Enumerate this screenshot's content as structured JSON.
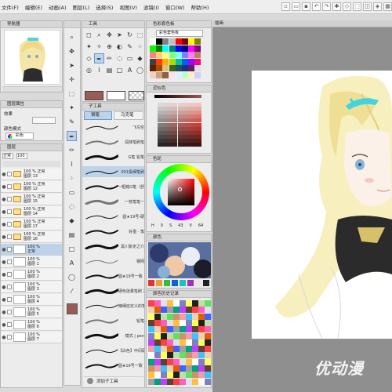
{
  "menu": [
    "文件(F)",
    "编辑(E)",
    "动画(A)",
    "图层(L)",
    "选择(S)",
    "视图(V)",
    "滤镜(I)",
    "窗口(W)",
    "帮助(H)"
  ],
  "navigator": {
    "title": "导航器"
  },
  "layer_property": {
    "title": "图层属性",
    "effect_label": "效果",
    "color_mode_label": "颜色模式",
    "color_value": "彩色"
  },
  "layers_panel": {
    "title": "图层",
    "blend": "正常",
    "opacity": "100",
    "rows": [
      {
        "text": "100 % 正常\n图层 13",
        "type": "folder"
      },
      {
        "text": "100 % 正常\n图层 12",
        "type": "folder"
      },
      {
        "text": "100 % 正常\n图层 15",
        "type": "folder"
      },
      {
        "text": "100 % 正常\n图层 14",
        "type": "folder"
      },
      {
        "text": "100 % 正常\n图层 17",
        "type": "folder"
      },
      {
        "text": "100 % 正常\n图层 16",
        "type": "folder"
      },
      {
        "text": "100 %\n正常",
        "type": "layer",
        "selected": true
      },
      {
        "text": "100 %\n图层 1",
        "type": "layer"
      },
      {
        "text": "100 %\n图层 2",
        "type": "layer"
      },
      {
        "text": "100 %\n图层 3",
        "type": "layer"
      },
      {
        "text": "100 %\n图层 4",
        "type": "layer"
      },
      {
        "text": "100 %\n图层 5",
        "type": "layer"
      },
      {
        "text": "100 %\n图层 6",
        "type": "layer"
      },
      {
        "text": "100 %\n图层 7",
        "type": "layer"
      }
    ]
  },
  "tools_panel": {
    "title": "工具"
  },
  "sub_tool": {
    "title": "子工具",
    "tab_pen": "钢笔",
    "tab_marker": "马克笔",
    "brushes": [
      {
        "name": "飞鸟空"
      },
      {
        "name": "润抹笔刷笔"
      },
      {
        "name": "G笔 铅笔"
      },
      {
        "name": "001极细笔刷"
      },
      {
        "name": "~粗糙G笔（舒华"
      },
      {
        "name": "一枝笔笔一"
      },
      {
        "name": "圆★19号-硬"
      },
      {
        "name": "好墨 · 笔"
      },
      {
        "name": "黑川复定之介"
      },
      {
        "name": "钢网"
      },
      {
        "name": "圆★19号一致（柔）"
      },
      {
        "name": "硬色批量笔刷 2"
      },
      {
        "name": "精细自定义的笔"
      },
      {
        "name": "铅笔"
      },
      {
        "name": "模式 | pen"
      },
      {
        "name": "【白色】中间硬中空笔 1"
      },
      {
        "name": "圆★19号一致（柔）"
      }
    ],
    "add_label": "添加子工具"
  },
  "color_set": {
    "title": "色彩套色板",
    "dropdown": "彩色套色板"
  },
  "color_history": {
    "title": "近似色"
  },
  "color_wheel": {
    "title": "色轮",
    "values": {
      "h": "0",
      "s": "43",
      "v": "64"
    }
  },
  "color_slider": {
    "title": "颜色"
  },
  "color_history2": {
    "title": "颜色历史记录"
  },
  "canvas": {
    "tab": "插画"
  },
  "watermark": "优动漫"
}
